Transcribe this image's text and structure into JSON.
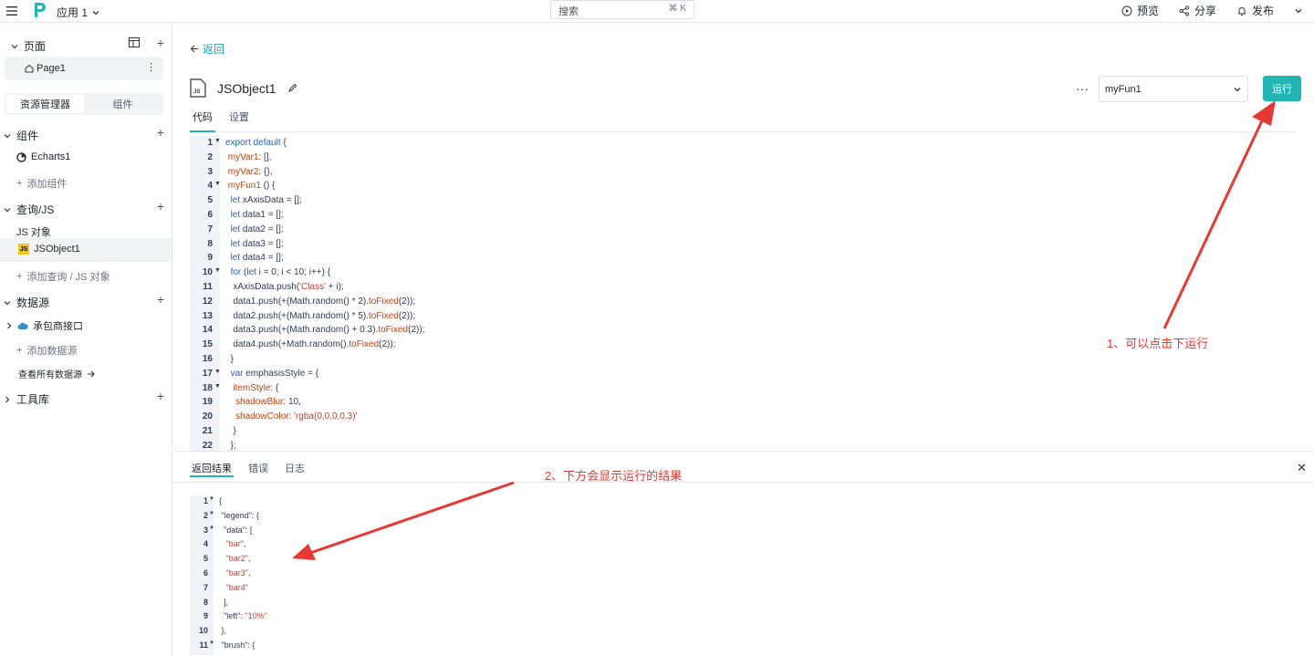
{
  "topbar": {
    "app_name": "应用 1",
    "search_placeholder": "搜索",
    "search_shortcut": "⌘ K",
    "preview": "预览",
    "share": "分享",
    "publish": "发布"
  },
  "sidebar": {
    "pages_header": "页面",
    "page1": "Page1",
    "tab_explorer": "资源管理器",
    "tab_components": "组件",
    "components_header": "组件",
    "echarts": "Echarts1",
    "add_component": "添加组件",
    "query_header": "查询/JS",
    "js_objects_label": "JS 对象",
    "jsobject1": "JSObject1",
    "add_query": "添加查询 / JS 对象",
    "datasource_header": "数据源",
    "datasource_item": "承包商接口",
    "add_datasource": "添加数据源",
    "view_all_datasources": "查看所有数据源",
    "toolbox_header": "工具库"
  },
  "main": {
    "back": "返回",
    "object_name": "JSObject1",
    "function_select": "myFun1",
    "run_button": "运行",
    "tabs": [
      "代码",
      "设置"
    ],
    "code_lines": [
      {
        "n": "1",
        "fold": true,
        "html": "<span class='kw'>export default</span> {"
      },
      {
        "n": "2",
        "fold": false,
        "html": " <span class='prop'>myVar1</span>: [],"
      },
      {
        "n": "3",
        "fold": false,
        "html": " <span class='prop'>myVar2</span>: {},"
      },
      {
        "n": "4",
        "fold": true,
        "html": " <span class='prop'>myFun1</span> () {"
      },
      {
        "n": "5",
        "fold": false,
        "html": "  <span class='kw'>let</span> xAxisData = [];"
      },
      {
        "n": "6",
        "fold": false,
        "html": "  <span class='kw'>let</span> data1 = [];"
      },
      {
        "n": "7",
        "fold": false,
        "html": "  <span class='kw'>let</span> data2 = [];"
      },
      {
        "n": "8",
        "fold": false,
        "html": "  <span class='kw'>let</span> data3 = [];"
      },
      {
        "n": "9",
        "fold": false,
        "html": "  <span class='kw'>let</span> data4 = [];"
      },
      {
        "n": "10",
        "fold": true,
        "html": "  <span class='kw'>for</span> (<span class='kw'>let</span> i = 0; i &lt; 10; i++) {"
      },
      {
        "n": "11",
        "fold": false,
        "html": "   xAxisData.push(<span class='str'>'Class'</span> + i);"
      },
      {
        "n": "12",
        "fold": false,
        "html": "   data1.push(+(Math.random() * 2).<span class='prop'>toFixed</span>(2));"
      },
      {
        "n": "13",
        "fold": false,
        "html": "   data2.push(+(Math.random() * 5).<span class='prop'>toFixed</span>(2));"
      },
      {
        "n": "14",
        "fold": false,
        "html": "   data3.push(+(Math.random() + 0.3).<span class='prop'>toFixed</span>(2));"
      },
      {
        "n": "15",
        "fold": false,
        "html": "   data4.push(+Math.random().<span class='prop'>toFixed</span>(2));"
      },
      {
        "n": "16",
        "fold": false,
        "html": "  }"
      },
      {
        "n": "17",
        "fold": true,
        "html": "  <span class='kw'>var</span> emphasisStyle = {"
      },
      {
        "n": "18",
        "fold": true,
        "html": "   <span class='prop'>itemStyle</span>: {"
      },
      {
        "n": "19",
        "fold": false,
        "html": "    <span class='prop'>shadowBlur</span>: 10,"
      },
      {
        "n": "20",
        "fold": false,
        "html": "    <span class='prop'>shadowColor</span>: <span class='str'>'rgba(0,0,0,0.3)'</span>"
      },
      {
        "n": "21",
        "fold": false,
        "html": "   }"
      },
      {
        "n": "22",
        "fold": false,
        "html": "  };"
      }
    ]
  },
  "bottom": {
    "tabs": [
      "返回结果",
      "错误",
      "日志"
    ],
    "result_lines": [
      {
        "n": "1",
        "fold": true,
        "html": "{"
      },
      {
        "n": "2",
        "fold": true,
        "html": " \"legend\": {"
      },
      {
        "n": "3",
        "fold": true,
        "html": "  \"data\": ["
      },
      {
        "n": "4",
        "fold": false,
        "html": "   <span class='str'>\"bar\"</span>,"
      },
      {
        "n": "5",
        "fold": false,
        "html": "   <span class='str'>\"bar2\"</span>,"
      },
      {
        "n": "6",
        "fold": false,
        "html": "   <span class='str'>\"bar3\"</span>,"
      },
      {
        "n": "7",
        "fold": false,
        "html": "   <span class='str'>\"bar4\"</span>"
      },
      {
        "n": "8",
        "fold": false,
        "html": "  ],"
      },
      {
        "n": "9",
        "fold": false,
        "html": "  \"left\": <span class='str'>\"10%\"</span>"
      },
      {
        "n": "10",
        "fold": false,
        "html": " },"
      },
      {
        "n": "11",
        "fold": true,
        "html": " \"brush\": {"
      }
    ]
  },
  "annotations": {
    "note1": "1、可以点击下运行",
    "note2": "2、下方会显示运行的结果"
  },
  "colors": {
    "accent": "#23b5b5",
    "annotation": "#e53935"
  }
}
